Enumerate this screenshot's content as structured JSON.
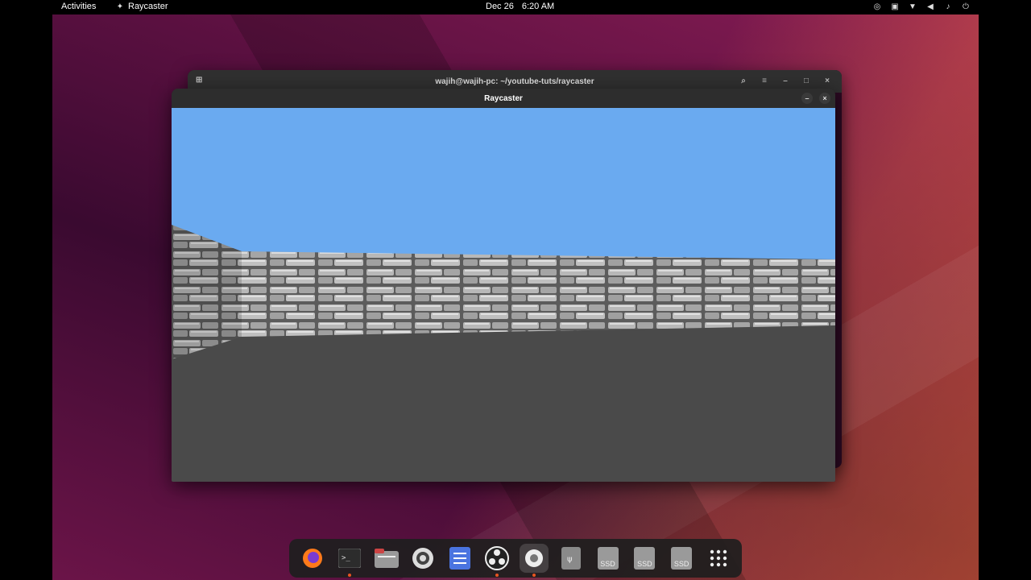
{
  "topbar": {
    "activities": "Activities",
    "app_name": "Raycaster",
    "date": "Dec 26",
    "time": "6:20 AM",
    "status_icons": [
      "color-picker-icon",
      "clipboard-icon",
      "wifi-icon",
      "volume-icon",
      "microphone-icon",
      "power-icon"
    ]
  },
  "terminal": {
    "title": "wajih@wajih-pc: ~/youtube-tuts/raycaster"
  },
  "game": {
    "title": "Raycaster",
    "colors": {
      "sky": "#6aaaf0",
      "floor": "#4a4a4a",
      "stone": "#a8a8a8"
    }
  },
  "dock": {
    "items": [
      {
        "name": "firefox-icon",
        "running": false
      },
      {
        "name": "terminal-icon",
        "running": true
      },
      {
        "name": "files-icon",
        "running": false
      },
      {
        "name": "settings-icon",
        "running": false
      },
      {
        "name": "tasks-icon",
        "running": false
      },
      {
        "name": "obs-icon",
        "running": true
      },
      {
        "name": "raycaster-app-icon",
        "running": true,
        "active": true
      },
      {
        "name": "usb-drive-icon",
        "running": false
      },
      {
        "name": "ssd-drive-icon",
        "label": "SSD"
      },
      {
        "name": "ssd-drive-icon",
        "label": "SSD"
      },
      {
        "name": "ssd-drive-icon",
        "label": "SSD"
      },
      {
        "name": "show-apps-icon",
        "running": false
      }
    ]
  }
}
